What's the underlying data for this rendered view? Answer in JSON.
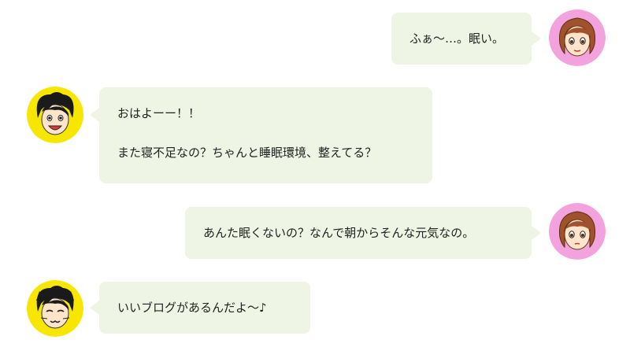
{
  "messages": [
    {
      "speaker": "woman",
      "side": "right",
      "lines": [
        "ふぁ～…。眠い。"
      ]
    },
    {
      "speaker": "man",
      "side": "left",
      "lines": [
        "おはよーー！！",
        "また寝不足なの？ちゃんと睡眠環境、整えてる？"
      ]
    },
    {
      "speaker": "woman",
      "side": "right",
      "lines": [
        "あんた眠くないの？なんで朝からそんな元気なの。"
      ]
    },
    {
      "speaker": "man",
      "side": "left",
      "lines": [
        "いいブログがあるんだよ～♪"
      ]
    }
  ],
  "avatars": {
    "woman": {
      "icon": "woman-face-icon",
      "bg": "#f2a3dd"
    },
    "man": {
      "icon": "man-face-icon",
      "bg": "#f7e600"
    },
    "man_cat": {
      "icon": "man-cat-face-icon",
      "bg": "#f7e600"
    }
  },
  "colors": {
    "bubble": "#eef5e4",
    "text": "#222222"
  }
}
